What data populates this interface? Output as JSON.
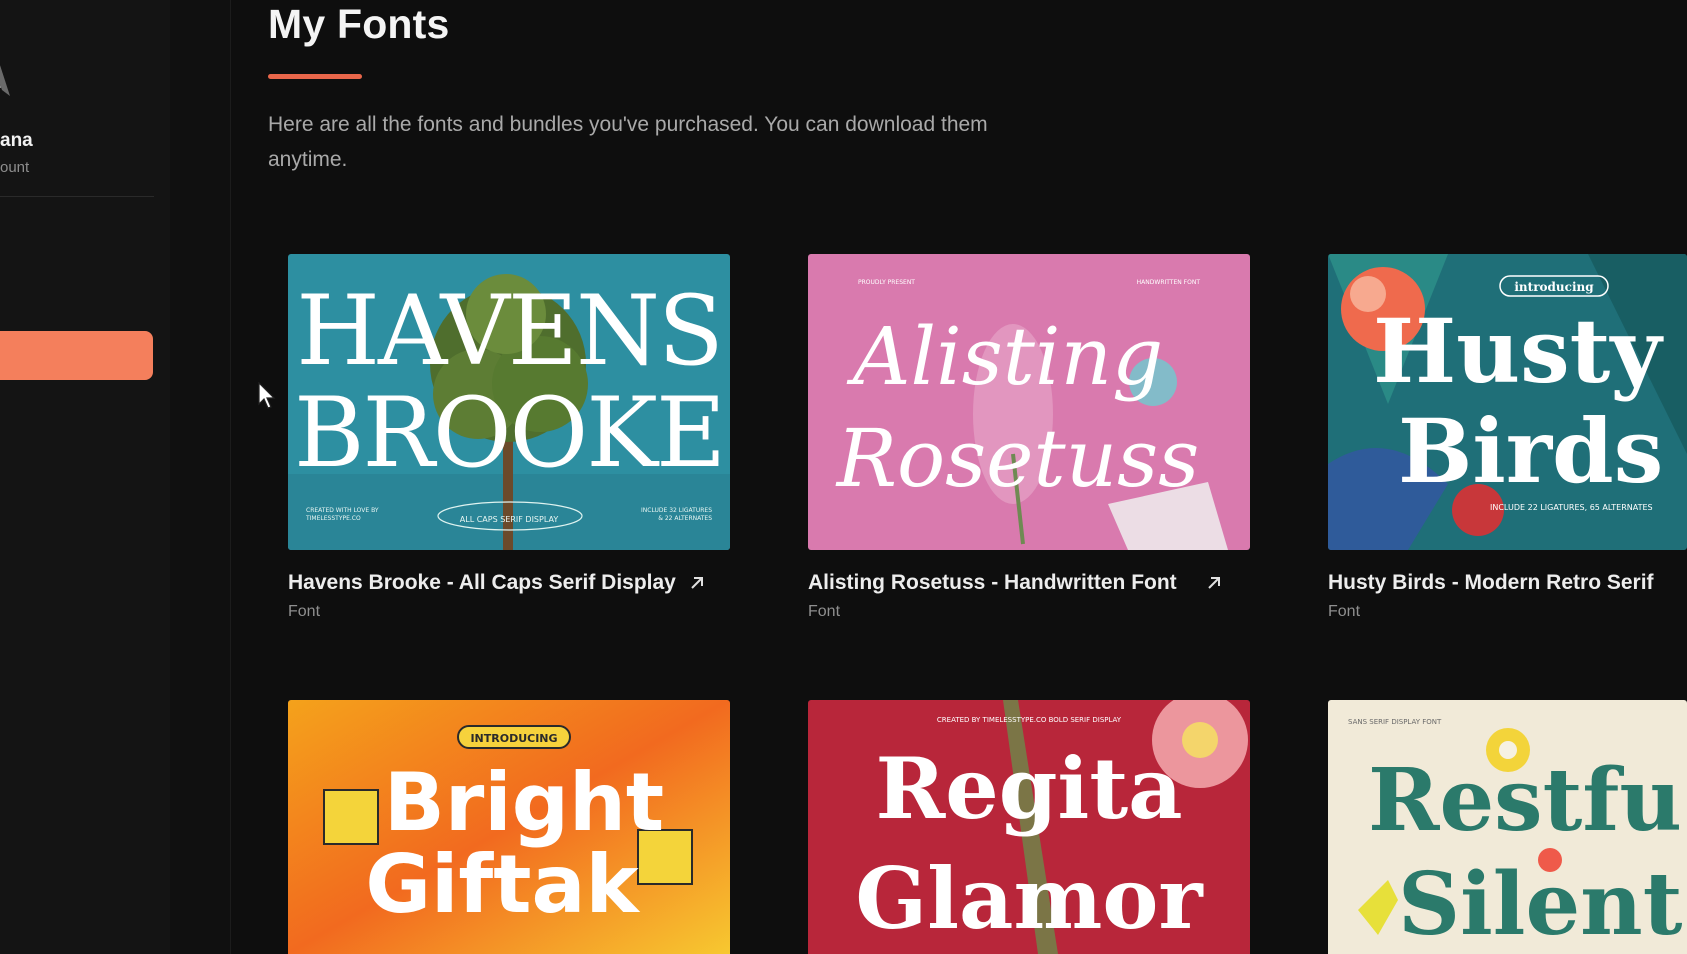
{
  "sidebar": {
    "user_name": "ana",
    "user_sub": "ount"
  },
  "main": {
    "title": "My Fonts",
    "intro": "Here are all the fonts and bundles you've purchased. You can download them anytime."
  },
  "cards": [
    {
      "title": "Havens Brooke - All Caps Serif Display",
      "type": "Font",
      "art_line1": "HAVENS",
      "art_line2": "BROOKE",
      "art_badge": "ALL CAPS SERIF DISPLAY",
      "art_small_left": "CREATED WITH LOVE BY",
      "art_small_left2": "TIMELESSTYPE.CO",
      "art_small_right": "INCLUDE 32 LIGATURES",
      "art_small_right2": "& 22 ALTERNATES"
    },
    {
      "title": "Alisting Rosetuss - Handwritten Font",
      "type": "Font",
      "art_line1": "Alisting",
      "art_line2": "Rosetuss",
      "art_top_left": "PROUDLY PRESENT",
      "art_top_right": "HANDWRITTEN FONT"
    },
    {
      "title": "Husty Birds - Modern Retro Serif",
      "type": "Font",
      "art_line1": "Husty",
      "art_line2": "Birds",
      "art_badge": "introducing",
      "art_small": "INCLUDE 22 LIGATURES, 65 ALTERNATES"
    },
    {
      "title": "",
      "type": "",
      "art_line1": "Bright",
      "art_line2": "Giftak",
      "art_badge": "INTRODUCING"
    },
    {
      "title": "",
      "type": "",
      "art_line1": "Regita",
      "art_line2": "Glamor",
      "art_top": "CREATED BY TIMELESSTYPE.CO  BOLD SERIF DISPLAY"
    },
    {
      "title": "",
      "type": "",
      "art_line1": "Restfu",
      "art_line2": "Silent",
      "art_top": "SANS SERIF DISPLAY FONT"
    }
  ],
  "colors": {
    "accent": "#f47f5c",
    "underline": "#e9664a",
    "background": "#0e0e0e"
  },
  "icons": {
    "external_link": "arrow-up-right-icon",
    "cursor": "mouse-pointer-icon"
  }
}
